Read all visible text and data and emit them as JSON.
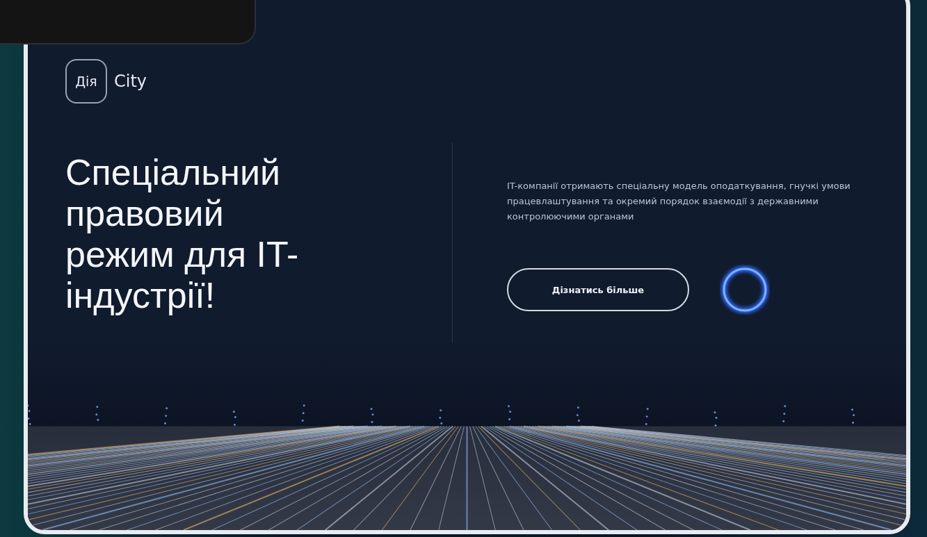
{
  "logo": {
    "mark": "Дія",
    "name": "City"
  },
  "headline_lines": [
    "Спеціальний",
    "правовий",
    "режим для IT-",
    "індустрії!"
  ],
  "description": "IT-компанії отримають спеціальну модель оподаткування, гнучкі умови працевлаштування та окремий порядок взаємодії з державними контролюючими органами",
  "button": {
    "label": "Дізнатись більше"
  }
}
